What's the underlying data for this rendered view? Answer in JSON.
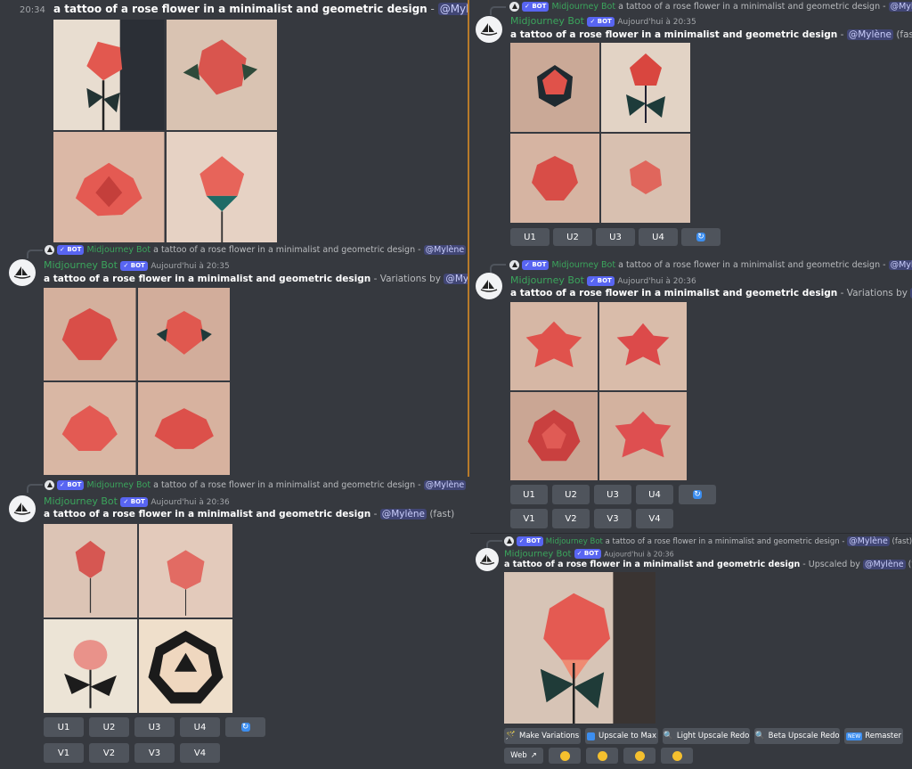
{
  "prompt": "a tattoo of a rose flower in a minimalist and geometric design",
  "bot_name": "Midjourney Bot",
  "bot_badge": "✓ BOT",
  "mention": "@Mylène",
  "fast": "(fast)",
  "dash": " - ",
  "variations_by": " - Variations by ",
  "upscaled_by": " - Upscaled by ",
  "panel1": {
    "time": "20:34"
  },
  "panel2": {
    "timestamp": "Aujourd'hui à 20:35",
    "u_buttons": [
      "U1",
      "U2",
      "U3",
      "U4"
    ]
  },
  "panel3": {
    "timestamp": "Aujourd'hui à 20:35"
  },
  "panel4": {
    "timestamp": "Aujourd'hui à 20:36",
    "u_buttons": [
      "U1",
      "U2",
      "U3",
      "U4"
    ],
    "v_buttons": [
      "V1",
      "V2",
      "V3",
      "V4"
    ]
  },
  "panel5": {
    "timestamp": "Aujourd'hui à 20:36",
    "u_buttons": [
      "U1",
      "U2",
      "U3",
      "U4"
    ],
    "v_buttons": [
      "V1",
      "V2",
      "V3",
      "V4"
    ]
  },
  "panel6": {
    "timestamp": "Aujourd'hui à 20:36",
    "actions": [
      "Make Variations",
      "Upscale to Max",
      "Light Upscale Redo",
      "Beta Upscale Redo",
      "Remaster"
    ],
    "remaster_badge": "NEW",
    "web_label": "Web"
  },
  "colors": {
    "background": "#36393f",
    "button": "#4f545c",
    "accent": "#5865f2",
    "bot_green": "#3ba55c",
    "mention_bg": "#414675",
    "panel_border": "#b87a2a"
  }
}
